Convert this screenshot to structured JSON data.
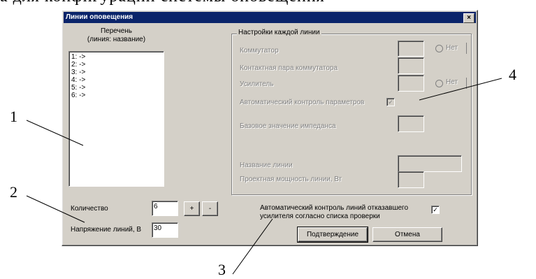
{
  "top_text": "а для конфигурации системы оповещения",
  "dialog": {
    "title": "Линии оповещения",
    "close_symbol": "×"
  },
  "list_section": {
    "heading": "Перечень",
    "subheading": "(линия: название)",
    "items": [
      "1: ->",
      "2: ->",
      "3: ->",
      "4: ->",
      "5: ->",
      "6: ->"
    ]
  },
  "settings": {
    "legend": "Настройки каждой линии",
    "commutator_label": "Коммутатор",
    "commutator_radio_label": "Нет",
    "contact_pair_label": "Контактная пара коммутатора",
    "amplifier_label": "Усилитель",
    "amplifier_radio_label": "Нет",
    "auto_control_label": "Автоматический контроль параметров",
    "auto_control_check": "✓",
    "impedance_label": "Базовое значение импеданса",
    "line_name_label": "Название линии",
    "design_power_label": "Проектная мощность линии, Вт"
  },
  "bottom": {
    "quantity_label": "Количество",
    "quantity_value": "6",
    "plus_label": "+",
    "minus_label": "-",
    "voltage_label": "Напряжение линий, В",
    "voltage_value": "30",
    "auto_line_control_label_1": "Автоматический контроль линий отказавшего",
    "auto_line_control_label_2": "усилителя согласно списка проверки",
    "auto_line_control_check": "✓",
    "confirm_label": "Подтверждение",
    "cancel_label": "Отмена"
  },
  "callouts": [
    "1",
    "2",
    "3",
    "4"
  ]
}
